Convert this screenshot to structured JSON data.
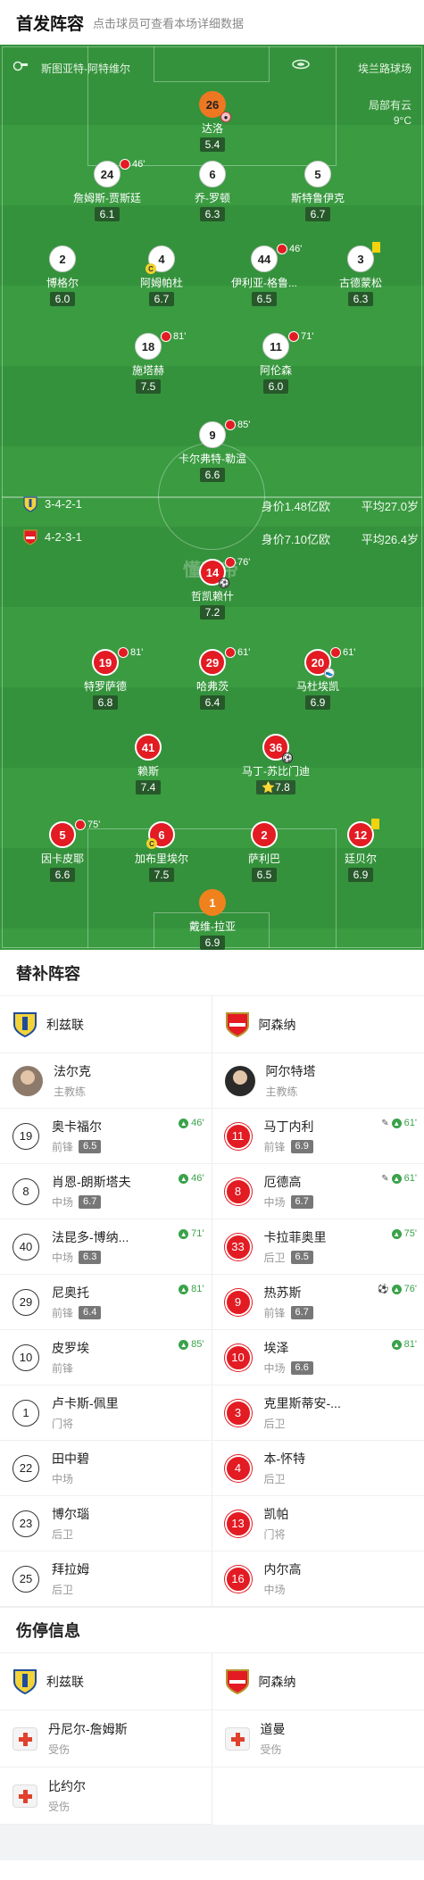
{
  "header": {
    "title": "首发阵容",
    "hint": "点击球员可查看本场详细数据"
  },
  "pitch": {
    "referee": "斯图亚特-阿特维尔",
    "stadium": "埃兰路球场",
    "weather": "局部有云",
    "temperature": "9°C",
    "watermark": "懂球帝",
    "home": {
      "formation": "3-4-2-1",
      "value": "身价1.48亿欧",
      "avg_age": "平均27.0岁"
    },
    "away": {
      "formation": "4-2-3-1",
      "value": "身价7.10亿欧",
      "avg_age": "平均26.4岁"
    },
    "colors": {
      "home_shirt": "#ffffff",
      "away_shirt": "#e31b23",
      "goalkeeper_home": "#ee7722",
      "pitch": "#3a9b41"
    }
  },
  "home_players": [
    {
      "num": "26",
      "name": "达洛",
      "rating": "5.4",
      "kit": "orange",
      "sub": ""
    },
    {
      "num": "24",
      "name": "詹姆斯-贾斯廷",
      "rating": "6.1",
      "kit": "white",
      "sub": "46'"
    },
    {
      "num": "6",
      "name": "乔-罗顿",
      "rating": "6.3",
      "kit": "white",
      "sub": ""
    },
    {
      "num": "5",
      "name": "斯特鲁伊克",
      "rating": "6.7",
      "kit": "white",
      "sub": ""
    },
    {
      "num": "2",
      "name": "博格尔",
      "rating": "6.0",
      "kit": "white",
      "sub": ""
    },
    {
      "num": "4",
      "name": "阿姆帕杜",
      "rating": "6.7",
      "kit": "white",
      "sub": ""
    },
    {
      "num": "44",
      "name": "伊利亚-格鲁...",
      "rating": "6.5",
      "kit": "white",
      "sub": "46'"
    },
    {
      "num": "3",
      "name": "古德蒙松",
      "rating": "6.3",
      "kit": "white",
      "sub": ""
    },
    {
      "num": "18",
      "name": "施塔赫",
      "rating": "7.5",
      "kit": "white",
      "sub": "81'"
    },
    {
      "num": "11",
      "name": "阿伦森",
      "rating": "6.0",
      "kit": "white",
      "sub": "71'"
    },
    {
      "num": "9",
      "name": "卡尔弗特-勒温",
      "rating": "6.6",
      "kit": "white",
      "sub": "85'"
    }
  ],
  "away_players": [
    {
      "num": "14",
      "name": "哲凯赖什",
      "rating": "7.2",
      "sub": "76'"
    },
    {
      "num": "19",
      "name": "特罗萨德",
      "rating": "6.8",
      "sub": "81'"
    },
    {
      "num": "29",
      "name": "哈弗茨",
      "rating": "6.4",
      "sub": "61'"
    },
    {
      "num": "20",
      "name": "马杜埃凯",
      "rating": "6.9",
      "sub": "61'"
    },
    {
      "num": "41",
      "name": "赖斯",
      "rating": "7.4",
      "sub": ""
    },
    {
      "num": "36",
      "name": "马丁-苏比门迪",
      "rating": "7.8",
      "sub": ""
    },
    {
      "num": "5",
      "name": "因卡皮耶",
      "rating": "6.6",
      "sub": "75'"
    },
    {
      "num": "6",
      "name": "加布里埃尔",
      "rating": "7.5",
      "sub": ""
    },
    {
      "num": "2",
      "name": "萨利巴",
      "rating": "6.5",
      "sub": ""
    },
    {
      "num": "12",
      "name": "廷贝尔",
      "rating": "6.9",
      "sub": ""
    },
    {
      "num": "1",
      "name": "戴维-拉亚",
      "rating": "6.9",
      "sub": ""
    }
  ],
  "subs": {
    "title": "替补阵容",
    "home": {
      "team": "利兹联",
      "coach": {
        "name": "法尔克",
        "role": "主教练"
      },
      "players": [
        {
          "num": "19",
          "name": "奥卡福尔",
          "pos": "前锋",
          "rating": "6.5",
          "in": "46'"
        },
        {
          "num": "8",
          "name": "肖恩-朗斯塔夫",
          "pos": "中场",
          "rating": "6.7",
          "in": "46'"
        },
        {
          "num": "40",
          "name": "法昆多-博纳...",
          "pos": "中场",
          "rating": "6.3",
          "in": "71'"
        },
        {
          "num": "29",
          "name": "尼奥托",
          "pos": "前锋",
          "rating": "6.4",
          "in": "81'"
        },
        {
          "num": "10",
          "name": "皮罗埃",
          "pos": "前锋",
          "rating": "",
          "in": "85'"
        },
        {
          "num": "1",
          "name": "卢卡斯-佩里",
          "pos": "门将",
          "rating": "",
          "in": ""
        },
        {
          "num": "22",
          "name": "田中碧",
          "pos": "中场",
          "rating": "",
          "in": ""
        },
        {
          "num": "23",
          "name": "博尔瑙",
          "pos": "后卫",
          "rating": "",
          "in": ""
        },
        {
          "num": "25",
          "name": "拜拉姆",
          "pos": "后卫",
          "rating": "",
          "in": ""
        }
      ]
    },
    "away": {
      "team": "阿森纳",
      "coach": {
        "name": "阿尔特塔",
        "role": "主教练"
      },
      "players": [
        {
          "num": "11",
          "name": "马丁内利",
          "pos": "前锋",
          "rating": "6.9",
          "in": "61'"
        },
        {
          "num": "8",
          "name": "厄德高",
          "pos": "中场",
          "rating": "6.7",
          "in": "61'"
        },
        {
          "num": "33",
          "name": "卡拉菲奥里",
          "pos": "后卫",
          "rating": "6.5",
          "in": "75'"
        },
        {
          "num": "9",
          "name": "热苏斯",
          "pos": "前锋",
          "rating": "6.7",
          "in": "76'"
        },
        {
          "num": "10",
          "name": "埃泽",
          "pos": "中场",
          "rating": "6.6",
          "in": "81'"
        },
        {
          "num": "3",
          "name": "克里斯蒂安-...",
          "pos": "后卫",
          "rating": "",
          "in": ""
        },
        {
          "num": "4",
          "name": "本-怀特",
          "pos": "后卫",
          "rating": "",
          "in": ""
        },
        {
          "num": "13",
          "name": "凯帕",
          "pos": "门将",
          "rating": "",
          "in": ""
        },
        {
          "num": "16",
          "name": "内尔高",
          "pos": "中场",
          "rating": "",
          "in": ""
        }
      ]
    }
  },
  "injuries": {
    "title": "伤停信息",
    "home": {
      "team": "利兹联",
      "players": [
        {
          "name": "丹尼尔-詹姆斯",
          "status": "受伤"
        },
        {
          "name": "比约尔",
          "status": "受伤"
        }
      ]
    },
    "away": {
      "team": "阿森纳",
      "players": [
        {
          "name": "道曼",
          "status": "受伤"
        }
      ]
    }
  }
}
